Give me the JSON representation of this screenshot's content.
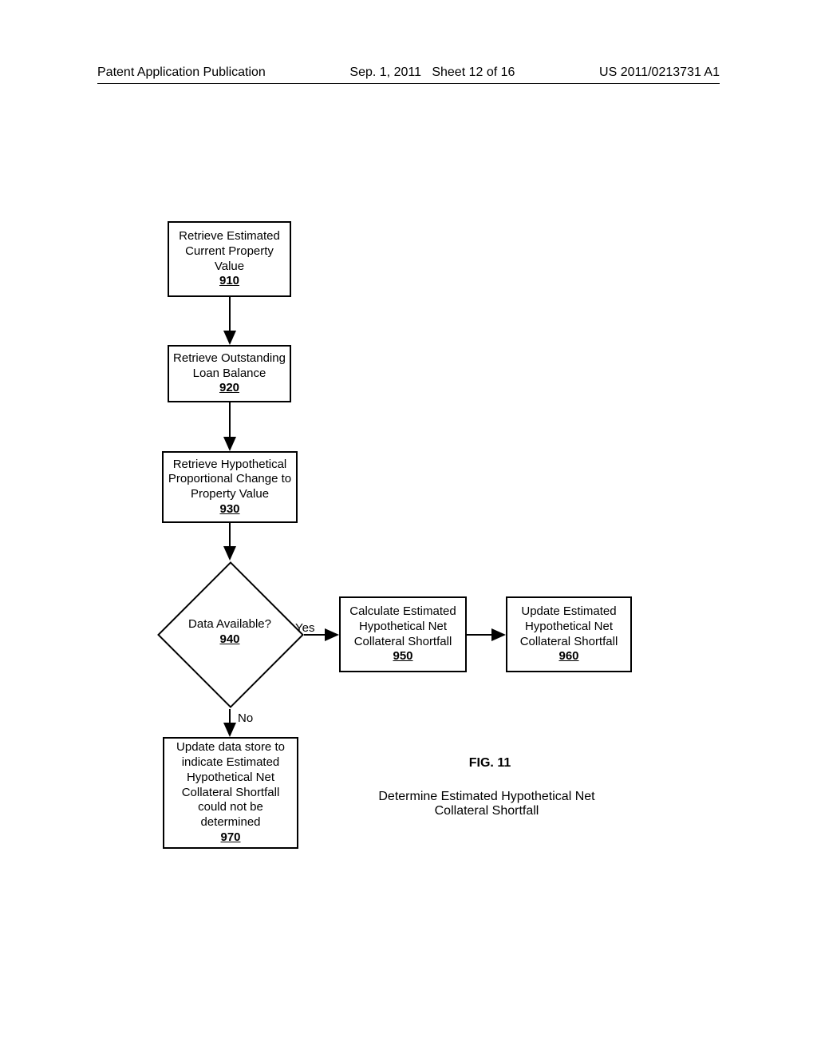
{
  "header": {
    "left": "Patent Application Publication",
    "date": "Sep. 1, 2011",
    "sheet": "Sheet 12 of 16",
    "pubno": "US 2011/0213731 A1"
  },
  "steps": {
    "s910": {
      "text": "Retrieve Estimated Current Property Value",
      "ref": "910"
    },
    "s920": {
      "text": "Retrieve Outstanding Loan Balance",
      "ref": "920"
    },
    "s930": {
      "text": "Retrieve Hypothetical Proportional Change to Property Value",
      "ref": "930"
    },
    "d940": {
      "text": "Data Available?",
      "ref": "940",
      "yes": "Yes",
      "no": "No"
    },
    "s950": {
      "text": "Calculate Estimated Hypothetical Net Collateral Shortfall",
      "ref": "950"
    },
    "s960": {
      "text": "Update Estimated Hypothetical Net Collateral Shortfall",
      "ref": "960"
    },
    "s970": {
      "text": "Update data store to indicate Estimated Hypothetical Net Collateral Shortfall could not be determined",
      "ref": "970"
    }
  },
  "figure": {
    "number": "FIG. 11",
    "caption": "Determine Estimated Hypothetical Net Collateral Shortfall"
  }
}
